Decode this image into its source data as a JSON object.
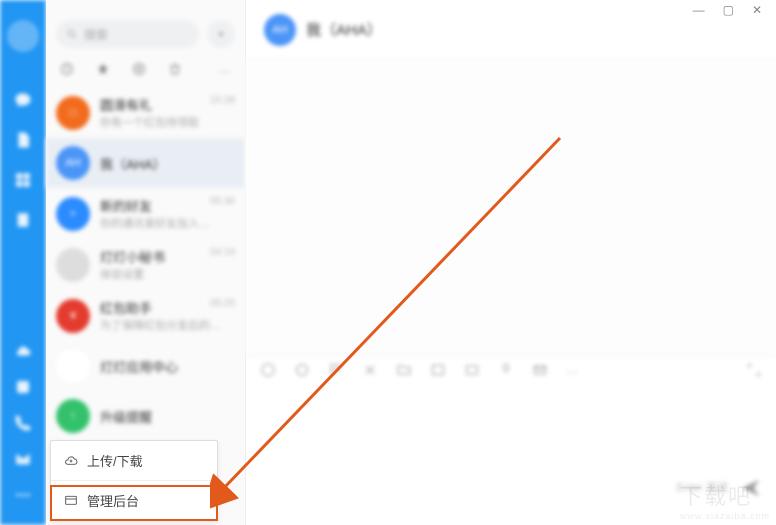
{
  "search": {
    "placeholder": "搜索"
  },
  "sidebar": {
    "labels": [
      "消息",
      "文档",
      "工作",
      "通讯录"
    ]
  },
  "tabs": {
    "more": "···"
  },
  "conversations": [
    {
      "name": "圆滑有礼",
      "sub": "你有一个红包待领取",
      "time": "15:28",
      "avbg": "#f26b1d",
      "initial": "□"
    },
    {
      "name": "我（AHA）",
      "sub": "",
      "time": "",
      "avbg": "#4b95f7",
      "initial": "AH",
      "selected": true
    },
    {
      "name": "新的好友",
      "sub": "你的通讯录好友加入…",
      "time": "05:36",
      "avbg": "#2b8cff",
      "initial": "+"
    },
    {
      "name": "灯灯小秘书",
      "sub": "体验设置",
      "time": "04:19",
      "avbg": "#dddddd",
      "initial": "",
      "img": true
    },
    {
      "name": "红包助手",
      "sub": "为了保障红包分发后的…",
      "time": "05:25",
      "avbg": "#e43b2f",
      "initial": "¥"
    },
    {
      "name": "灯灯应用中心",
      "sub": "",
      "time": "",
      "avbg": "#ffffff",
      "initial": "◆"
    },
    {
      "name": "升级提醒",
      "sub": "",
      "time": "",
      "avbg": "#33c26b",
      "initial": "↑"
    }
  ],
  "chat": {
    "title": "我（AHA）",
    "avatar_initial": "AH",
    "send_hint": "Enter 发送"
  },
  "popup": {
    "upload_download": "上传/下载",
    "admin_console": "管理后台"
  },
  "windowControls": {
    "min": "—",
    "max": "▢",
    "close": "✕"
  },
  "watermark": {
    "text": "下载吧",
    "url": "www.xiazaiba.com"
  }
}
